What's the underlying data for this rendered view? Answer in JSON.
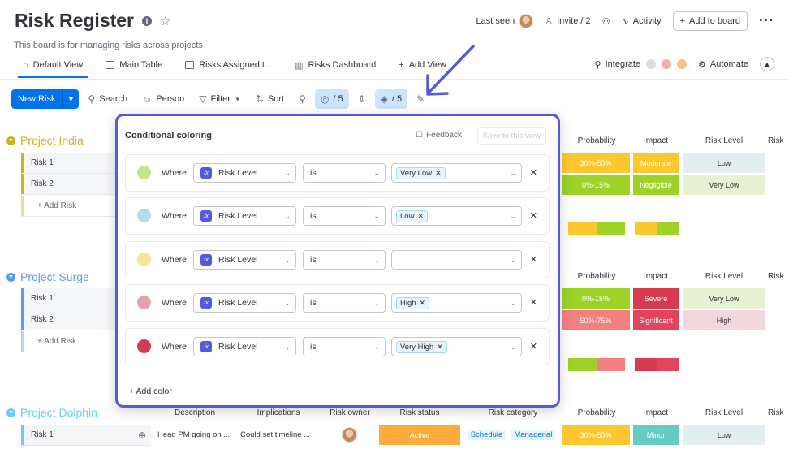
{
  "header": {
    "title": "Risk Register",
    "subtitle": "This board is for managing risks across projects",
    "last_seen": "Last seen",
    "invite": "Invite / 2",
    "activity": "Activity",
    "add_to_board": "Add to board"
  },
  "tabs": [
    {
      "label": "Default View",
      "active": true
    },
    {
      "label": "Main Table"
    },
    {
      "label": "Risks Assigned t..."
    },
    {
      "label": "Risks Dashboard"
    },
    {
      "label": "Add View"
    }
  ],
  "tabs_right": {
    "integrate": "Integrate",
    "automate": "Automate"
  },
  "toolbar": {
    "new_item": "New Risk",
    "search": "Search",
    "person": "Person",
    "filter": "Filter",
    "sort": "Sort",
    "hide_count": "/ 5",
    "color_count": "/ 5"
  },
  "groups": [
    {
      "name": "Project India",
      "color": "#c9b41e",
      "rows": [
        "Risk 1",
        "Risk 2"
      ],
      "add_label": "+ Add Risk"
    },
    {
      "name": "Project Surge",
      "color": "#579bfc",
      "rows": [
        "Risk 1",
        "Risk 2"
      ],
      "add_label": "+ Add Risk"
    },
    {
      "name": "Project Dolphin",
      "color": "#66ccff",
      "rows": [
        "Risk 1"
      ]
    }
  ],
  "columns_right": [
    "Probability",
    "Impact",
    "Risk Level",
    "Risk"
  ],
  "columns_dolphin": [
    "Description",
    "Implications",
    "Risk owner",
    "Risk status",
    "Risk category"
  ],
  "india_cells": [
    {
      "probability": "30%-50%",
      "impact": "Moderate",
      "level": "Low"
    },
    {
      "probability": "0%-15%",
      "impact": "Negligible",
      "level": "Very Low"
    }
  ],
  "surge_cells": [
    {
      "probability": "0%-15%",
      "impact": "Severe",
      "level": "Very Low"
    },
    {
      "probability": "50%-75%",
      "impact": "Significant",
      "level": "High"
    }
  ],
  "dolphin_row": {
    "description": "Head PM going on ...",
    "implications": "Could set timeline ...",
    "status": "Active",
    "category_1": "Schedule",
    "category_2": "Managerial",
    "probability": "30%-50%",
    "impact": "Minor",
    "level": "Low"
  },
  "panel": {
    "title": "Conditional coloring",
    "feedback": "Feedback",
    "save_view": "Save to this view",
    "where": "Where",
    "add_color": "+ Add color",
    "rules": [
      {
        "color": "#c6e58c",
        "column": "Risk Level",
        "op": "is",
        "value": "Very Low"
      },
      {
        "color": "#b6dde6",
        "column": "Risk Level",
        "op": "is",
        "value": "Low"
      },
      {
        "color": "#fbe39a",
        "column": "Risk Level",
        "op": "is",
        "value": ""
      },
      {
        "color": "#e2a4ac",
        "column": "Risk Level",
        "op": "is",
        "value": "High"
      },
      {
        "color": "#d83a52",
        "column": "Risk Level",
        "op": "is",
        "value": "Very High"
      }
    ]
  },
  "colors": {
    "accent": "#0073ea",
    "panel_border": "#5559df",
    "yellow": "#fdc72f",
    "green": "#9cd326",
    "red": "#e2445c",
    "salmon": "#f47f7f",
    "teal": "#66ccc2"
  }
}
